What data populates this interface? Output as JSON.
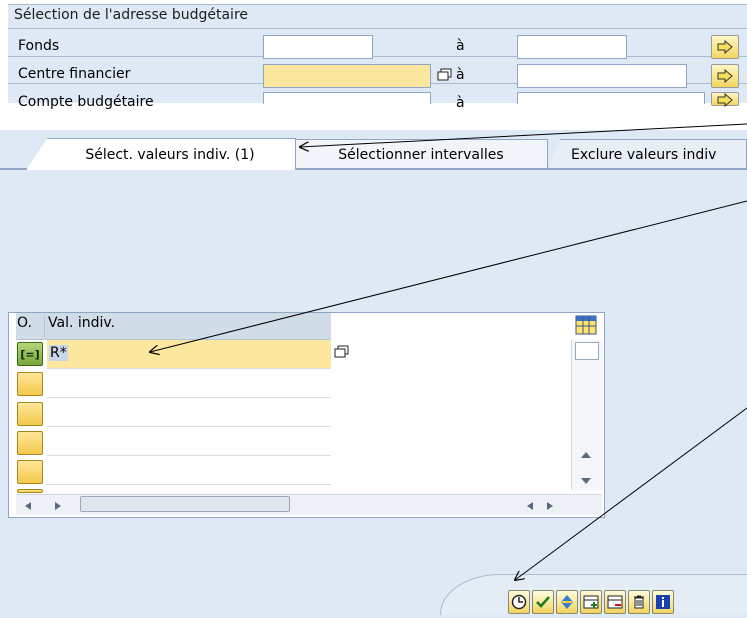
{
  "top_panel": {
    "title": "Sélection de l'adresse budgétaire",
    "rows": [
      {
        "label": "Fonds",
        "to": "à"
      },
      {
        "label": "Centre financier",
        "to": "à"
      },
      {
        "label": "Compte budgétaire",
        "to": "à"
      }
    ]
  },
  "tabs": [
    {
      "label": "Sélect. valeurs indiv. (1)",
      "active": true
    },
    {
      "label": "Sélectionner intervalles",
      "active": false
    },
    {
      "label": "Exclure valeurs indiv",
      "active": false
    }
  ],
  "table": {
    "headers": {
      "o": "O.",
      "val": "Val. indiv."
    },
    "first_row_selector": "[=]",
    "first_row_value": "R*"
  },
  "icons": {
    "arrow": "arrow-right-icon",
    "copy": "multiple-selection-icon",
    "settings": "table-settings-icon",
    "toolbar": [
      "execute-clock-icon",
      "check-icon",
      "import-icon",
      "add-row-icon",
      "delete-row-icon",
      "trash-icon",
      "info-icon"
    ]
  },
  "colors": {
    "panel": "#dfe9f5",
    "required": "#fbe79d",
    "button": "#f3c94b"
  }
}
